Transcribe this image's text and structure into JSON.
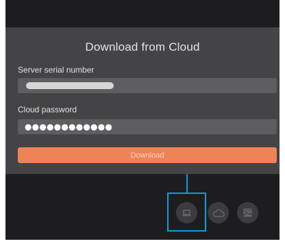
{
  "dialog": {
    "title": "Download from Cloud",
    "serial_label": "Server serial number",
    "serial_value_masked": true,
    "password_label": "Cloud password",
    "password_value": "●●●●●●●●●●●●",
    "download_label": "Download"
  },
  "bottom_bar": {
    "icons": [
      "laptop-icon",
      "cloud-icon",
      "image-icon"
    ],
    "highlighted_icon": "laptop-icon"
  },
  "colors": {
    "background": "#1d1d1f",
    "dialog": "#444446",
    "field": "#5e5e60",
    "accent": "#ef8356",
    "highlight": "#0d9de0"
  }
}
